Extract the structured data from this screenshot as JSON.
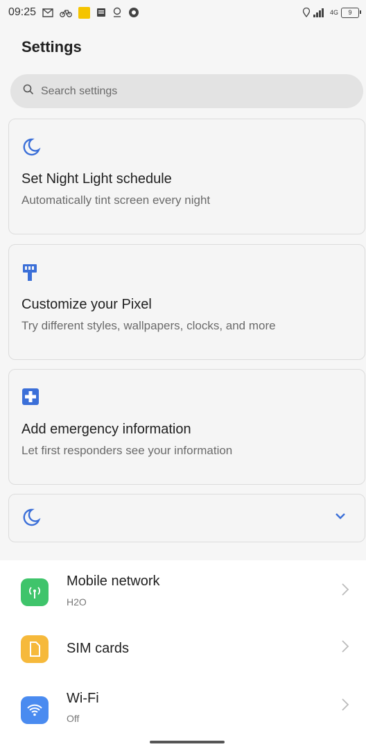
{
  "status_bar": {
    "time": "09:25",
    "left_icons": [
      "gmail-icon",
      "bike-icon",
      "yellow-app-icon",
      "message-icon",
      "location-icon",
      "browser-icon"
    ],
    "right_icons": [
      "location-icon",
      "signal-icon",
      "battery-icon"
    ],
    "network_label": "4G",
    "battery_level": "9"
  },
  "header": {
    "title": "Settings"
  },
  "search": {
    "placeholder": "Search settings"
  },
  "suggestions": [
    {
      "icon": "moon-icon",
      "title": "Set Night Light schedule",
      "subtitle": "Automatically tint screen every night"
    },
    {
      "icon": "brush-icon",
      "title": "Customize your Pixel",
      "subtitle": "Try different styles, wallpapers, clocks, and more"
    },
    {
      "icon": "medical-plus-icon",
      "title": "Add emergency information",
      "subtitle": "Let first responders see your information"
    }
  ],
  "collapsed_card": {
    "icon": "moon-icon",
    "expand_icon": "chevron-down-icon"
  },
  "settings_list": [
    {
      "icon": "antenna-icon",
      "color": "#3fc46b",
      "title": "Mobile network",
      "subtitle": "H2O"
    },
    {
      "icon": "sim-card-icon",
      "color": "#f6b93b",
      "title": "SIM cards",
      "subtitle": ""
    },
    {
      "icon": "wifi-icon",
      "color": "#4a8bf0",
      "title": "Wi-Fi",
      "subtitle": "Off"
    }
  ],
  "colors": {
    "accent": "#3b6fd8",
    "background": "#f6f6f6"
  }
}
